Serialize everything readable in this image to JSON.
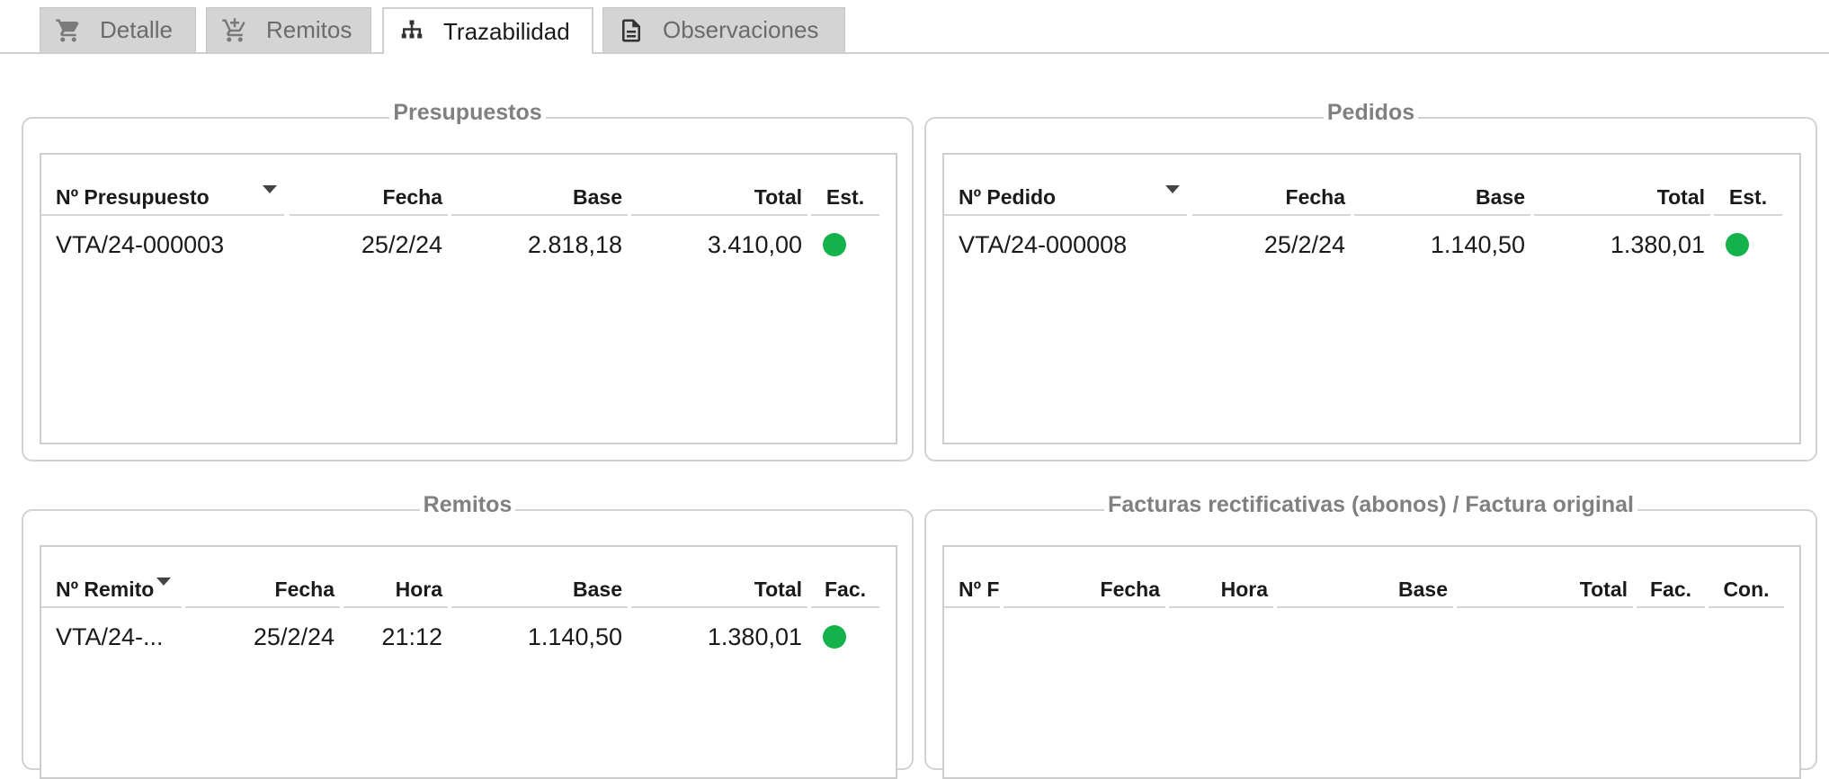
{
  "tabs": [
    {
      "label": "Detalle",
      "icon": "cart-icon",
      "active": false
    },
    {
      "label": "Remitos",
      "icon": "cart-icon",
      "active": false
    },
    {
      "label": "Trazabilidad",
      "icon": "hierarchy-icon",
      "active": true
    },
    {
      "label": "Observaciones",
      "icon": "document-icon",
      "active": false
    }
  ],
  "colors": {
    "status_green": "#14b24a",
    "tab_inactive": "#d4d4d4",
    "group_title": "#808080"
  },
  "presupuestos": {
    "title": "Presupuestos",
    "columns": [
      "Nº Presupuesto",
      "Fecha",
      "Base",
      "Total",
      "Est."
    ],
    "rows": [
      {
        "numero": "VTA/24-000003",
        "fecha": "25/2/24",
        "base": "2.818,18",
        "total": "3.410,00",
        "estado": "green"
      }
    ]
  },
  "pedidos": {
    "title": "Pedidos",
    "columns": [
      "Nº Pedido",
      "Fecha",
      "Base",
      "Total",
      "Est."
    ],
    "rows": [
      {
        "numero": "VTA/24-000008",
        "fecha": "25/2/24",
        "base": "1.140,50",
        "total": "1.380,01",
        "estado": "green"
      }
    ]
  },
  "remitos": {
    "title": "Remitos",
    "columns": [
      "Nº Remito",
      "Fecha",
      "Hora",
      "Base",
      "Total",
      "Fac."
    ],
    "rows": [
      {
        "numero": "VTA/24-...",
        "fecha": "25/2/24",
        "hora": "21:12",
        "base": "1.140,50",
        "total": "1.380,01",
        "facturado": "green"
      }
    ]
  },
  "facturas": {
    "title": "Facturas rectificativas (abonos) / Factura original",
    "columns": [
      "Nº Fa",
      "Fecha",
      "Hora",
      "Base",
      "Total",
      "Fac.",
      "Con."
    ],
    "rows": []
  }
}
